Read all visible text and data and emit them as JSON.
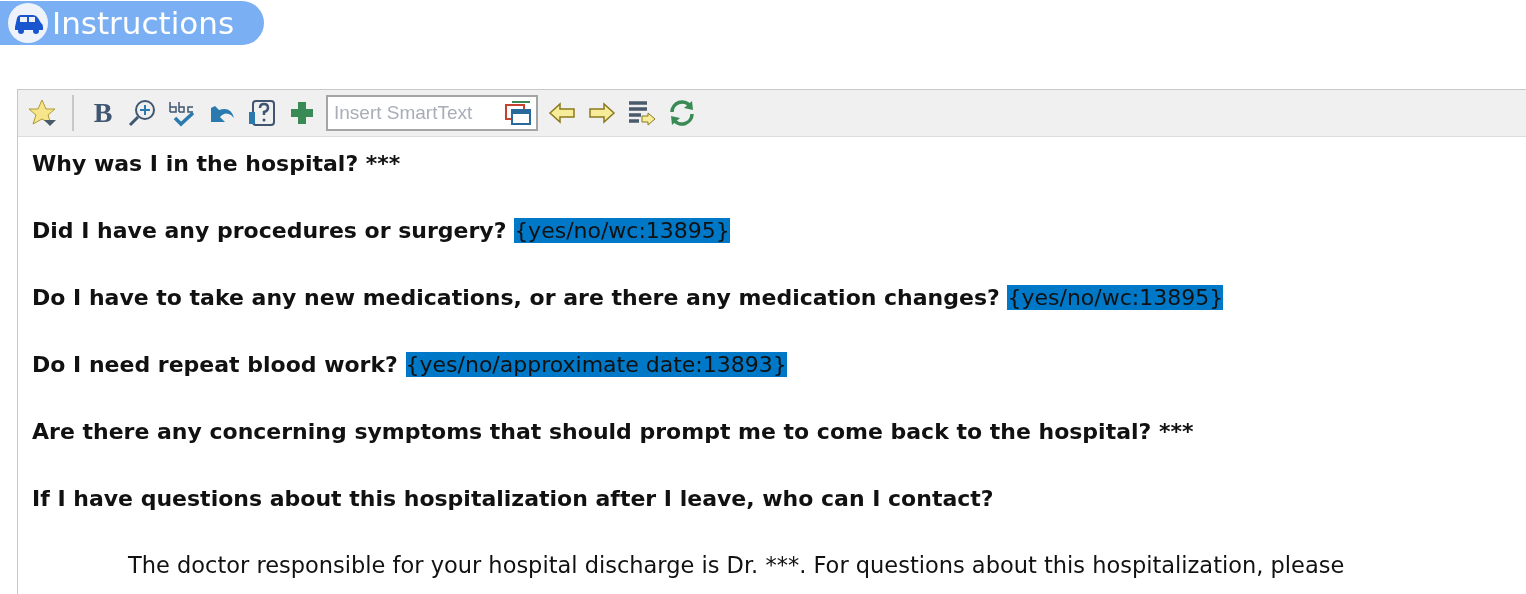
{
  "header": {
    "title": "Instructions"
  },
  "toolbar": {
    "bold_label": "B",
    "smarttext": {
      "placeholder": "Insert SmartText"
    }
  },
  "paragraphs": [
    {
      "kind": "question",
      "text": "Why was I in the hospital? ***"
    },
    {
      "kind": "question",
      "text": "Did I have any procedures or surgery?",
      "smartlink": "{yes/no/wc:13895}"
    },
    {
      "kind": "question",
      "text": "Do I have to take any new medications, or are there any medication changes?",
      "smartlink": "{yes/no/wc:13895}"
    },
    {
      "kind": "question",
      "text": "Do I need repeat blood work?",
      "smartlink": "{yes/no/approximate date:13893}"
    },
    {
      "kind": "question",
      "text": "Are there any concerning symptoms that should prompt me to come back to the hospital? ***"
    },
    {
      "kind": "question",
      "text": "If I have questions about this hospitalization after I leave, who can I contact?"
    },
    {
      "kind": "body",
      "text": "The doctor responsible for your hospital discharge is Dr. ***. For questions about this hospitalization, please"
    }
  ]
}
